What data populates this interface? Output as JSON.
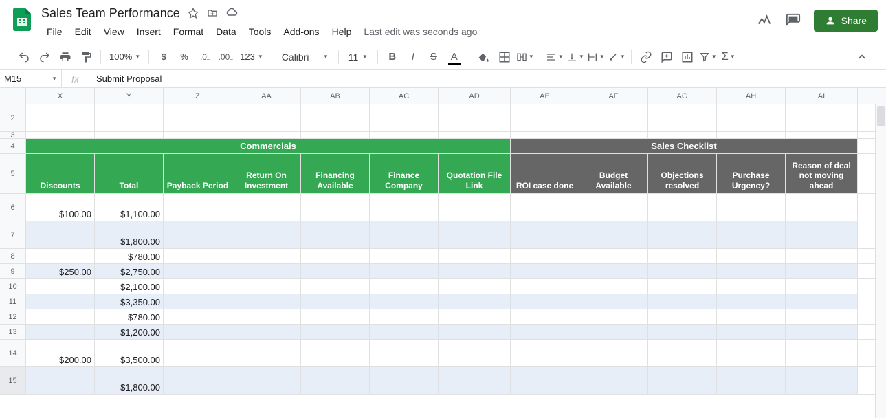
{
  "doc": {
    "title": "Sales Team Performance"
  },
  "menus": [
    "File",
    "Edit",
    "View",
    "Insert",
    "Format",
    "Data",
    "Tools",
    "Add-ons",
    "Help"
  ],
  "last_edit": "Last edit was seconds ago",
  "share_label": "Share",
  "toolbar": {
    "zoom": "100%",
    "font": "Calibri",
    "font_size": "11",
    "number_format": "123"
  },
  "formula": {
    "cell_ref": "M15",
    "value": "Submit Proposal"
  },
  "columns": [
    {
      "letter": "X",
      "width": 100
    },
    {
      "letter": "Y",
      "width": 100
    },
    {
      "letter": "Z",
      "width": 100
    },
    {
      "letter": "AA",
      "width": 100
    },
    {
      "letter": "AB",
      "width": 100
    },
    {
      "letter": "AC",
      "width": 100
    },
    {
      "letter": "AD",
      "width": 105
    },
    {
      "letter": "AE",
      "width": 100
    },
    {
      "letter": "AF",
      "width": 100
    },
    {
      "letter": "AG",
      "width": 100
    },
    {
      "letter": "AH",
      "width": 100
    },
    {
      "letter": "AI",
      "width": 105
    }
  ],
  "rows_meta": [
    {
      "n": 2,
      "h": 40
    },
    {
      "n": 3,
      "h": 10
    },
    {
      "n": 4,
      "h": 22
    },
    {
      "n": 5,
      "h": 58
    },
    {
      "n": 6,
      "h": 40
    },
    {
      "n": 7,
      "h": 40
    },
    {
      "n": 8,
      "h": 22
    },
    {
      "n": 9,
      "h": 22
    },
    {
      "n": 10,
      "h": 22
    },
    {
      "n": 11,
      "h": 22
    },
    {
      "n": 12,
      "h": 22
    },
    {
      "n": 13,
      "h": 22
    },
    {
      "n": 14,
      "h": 40
    },
    {
      "n": 15,
      "h": 40
    }
  ],
  "section_headers": {
    "commercials": "Commercials",
    "checklist": "Sales Checklist"
  },
  "sub_headers_green": [
    "Discounts",
    "Total",
    "Payback Period",
    "Return On Investment",
    "Financing Available",
    "Finance Company",
    "Quotation File Link"
  ],
  "sub_headers_gray": [
    "ROI case done",
    "Budget Available",
    "Objections resolved",
    "Purchase Urgency?",
    "Reason of deal not moving ahead"
  ],
  "data_rows": [
    {
      "alt": false,
      "discount": "$100.00",
      "total": "$1,100.00"
    },
    {
      "alt": true,
      "discount": "",
      "total": "$1,800.00"
    },
    {
      "alt": false,
      "discount": "",
      "total": "$780.00"
    },
    {
      "alt": true,
      "discount": "$250.00",
      "total": "$2,750.00"
    },
    {
      "alt": false,
      "discount": "",
      "total": "$2,100.00"
    },
    {
      "alt": true,
      "discount": "",
      "total": "$3,350.00"
    },
    {
      "alt": false,
      "discount": "",
      "total": "$780.00"
    },
    {
      "alt": true,
      "discount": "",
      "total": "$1,200.00"
    },
    {
      "alt": false,
      "discount": "$200.00",
      "total": "$3,500.00"
    },
    {
      "alt": true,
      "discount": "",
      "total": "$1,800.00"
    }
  ],
  "selected_row": 15
}
